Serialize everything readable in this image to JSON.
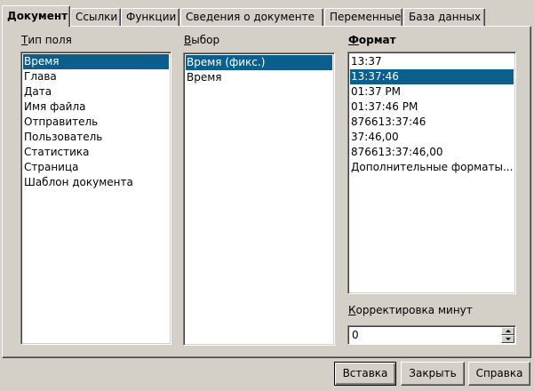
{
  "tabs": [
    {
      "label": "Документ"
    },
    {
      "label": "Ссылки"
    },
    {
      "label": "Функции"
    },
    {
      "label": "Сведения о документе"
    },
    {
      "label": "Переменные"
    },
    {
      "label": "База данных"
    }
  ],
  "field_type": {
    "label_first": "Т",
    "label_rest": "ип поля",
    "items": [
      "Время",
      "Глава",
      "Дата",
      "Имя файла",
      "Отправитель",
      "Пользователь",
      "Статистика",
      "Страница",
      "Шаблон документа"
    ],
    "selected": "Время"
  },
  "selection": {
    "label_first": "В",
    "label_rest": "ыбор",
    "items": [
      "Время (фикс.)",
      "Время"
    ],
    "selected": "Время (фикс.)"
  },
  "format": {
    "label_first": "Ф",
    "label_rest": "ормат",
    "items": [
      "13:37",
      "13:37:46",
      "01:37 PM",
      "01:37:46 PM",
      "876613:37:46",
      "37:46,00",
      "876613:37:46,00",
      "Дополнительные форматы..."
    ],
    "selected": "13:37:46"
  },
  "offset": {
    "label_first": "К",
    "label_rest": "орректировка минут",
    "value": "0"
  },
  "buttons": {
    "insert": "Вставка",
    "close": "Закрыть",
    "help": "Справка"
  },
  "colors": {
    "selection": "#0a5f8c",
    "dialog_bg": "#d4d0c8"
  }
}
